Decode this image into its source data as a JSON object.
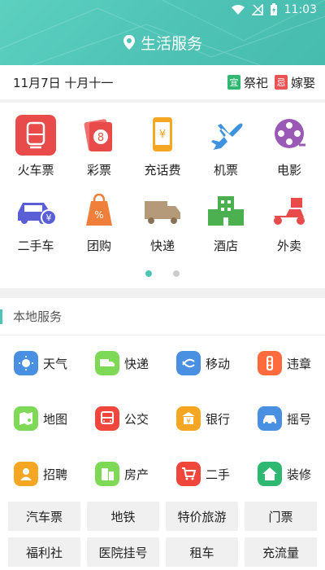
{
  "status": {
    "time": "11:03"
  },
  "header": {
    "title": "生活服务"
  },
  "datebar": {
    "date": "11月7日 十月十一",
    "tags": [
      {
        "mark": "宜",
        "text": "祭祀",
        "color": "#2eb872"
      },
      {
        "mark": "忌",
        "text": "嫁娶",
        "color": "#e85454"
      }
    ]
  },
  "main": {
    "row1": [
      {
        "label": "火车票",
        "icon": "train-icon"
      },
      {
        "label": "彩票",
        "icon": "lottery-icon"
      },
      {
        "label": "充话费",
        "icon": "phone-recharge-icon"
      },
      {
        "label": "机票",
        "icon": "airplane-icon"
      },
      {
        "label": "电影",
        "icon": "film-reel-icon"
      }
    ],
    "row2": [
      {
        "label": "二手车",
        "icon": "used-car-icon"
      },
      {
        "label": "团购",
        "icon": "group-buy-icon"
      },
      {
        "label": "快递",
        "icon": "truck-icon"
      },
      {
        "label": "酒店",
        "icon": "hotel-icon"
      },
      {
        "label": "外卖",
        "icon": "scooter-icon"
      }
    ],
    "page": 1,
    "pages": 2
  },
  "local": {
    "title": "本地服务",
    "items": [
      {
        "label": "天气",
        "icon": "weather-icon",
        "color": "#4a90e2"
      },
      {
        "label": "快递",
        "icon": "express-icon",
        "color": "#7ed957"
      },
      {
        "label": "移动",
        "icon": "china-mobile-icon",
        "color": "#4a90e2"
      },
      {
        "label": "违章",
        "icon": "traffic-light-icon",
        "color": "#ff6b3d"
      },
      {
        "label": "地图",
        "icon": "map-icon",
        "color": "#7ed957"
      },
      {
        "label": "公交",
        "icon": "bus-icon",
        "color": "#f0463c"
      },
      {
        "label": "银行",
        "icon": "bank-icon",
        "color": "#f5a623"
      },
      {
        "label": "摇号",
        "icon": "car-lottery-icon",
        "color": "#4a90e2"
      },
      {
        "label": "招聘",
        "icon": "recruit-icon",
        "color": "#f5a623"
      },
      {
        "label": "房产",
        "icon": "building-icon",
        "color": "#7ed957"
      },
      {
        "label": "二手",
        "icon": "cart-icon",
        "color": "#f0463c"
      },
      {
        "label": "装修",
        "icon": "house-icon",
        "color": "#2eb872"
      }
    ],
    "buttons_row1": [
      "汽车票",
      "地铁",
      "特价旅游",
      "门票"
    ],
    "buttons_row2": [
      "福利社",
      "医院挂号",
      "租车",
      "充流量"
    ]
  }
}
